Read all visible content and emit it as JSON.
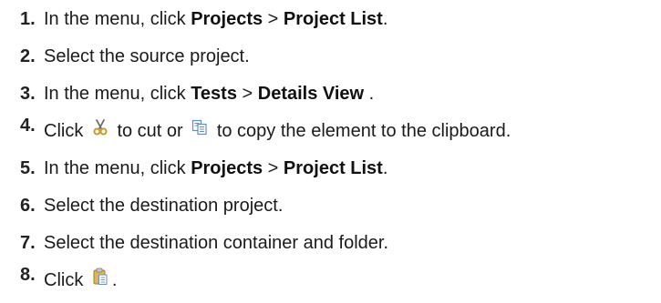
{
  "steps": [
    {
      "number": "1.",
      "text_before": "In the menu, click ",
      "bold1": "Projects",
      "separator": " > ",
      "bold2": "Project List",
      "text_after": "."
    },
    {
      "number": "2.",
      "text": "Select the source project."
    },
    {
      "number": "3.",
      "text_before": "In the menu, click ",
      "bold1": "Tests",
      "separator": " > ",
      "bold2": "Details View",
      "text_after": " ."
    },
    {
      "number": "4.",
      "text_before": "Click ",
      "icon1": "cut-icon",
      "text_middle": " to cut or ",
      "icon2": "copy-icon",
      "text_after": " to copy the element to the clipboard."
    },
    {
      "number": "5.",
      "text_before": "In the menu, click ",
      "bold1": "Projects",
      "separator": " > ",
      "bold2": "Project List",
      "text_after": "."
    },
    {
      "number": "6.",
      "text": "Select the destination project."
    },
    {
      "number": "7.",
      "text": "Select the destination container and folder."
    },
    {
      "number": "8.",
      "text_before": "Click ",
      "icon1": "paste-icon",
      "text_after": "."
    }
  ]
}
